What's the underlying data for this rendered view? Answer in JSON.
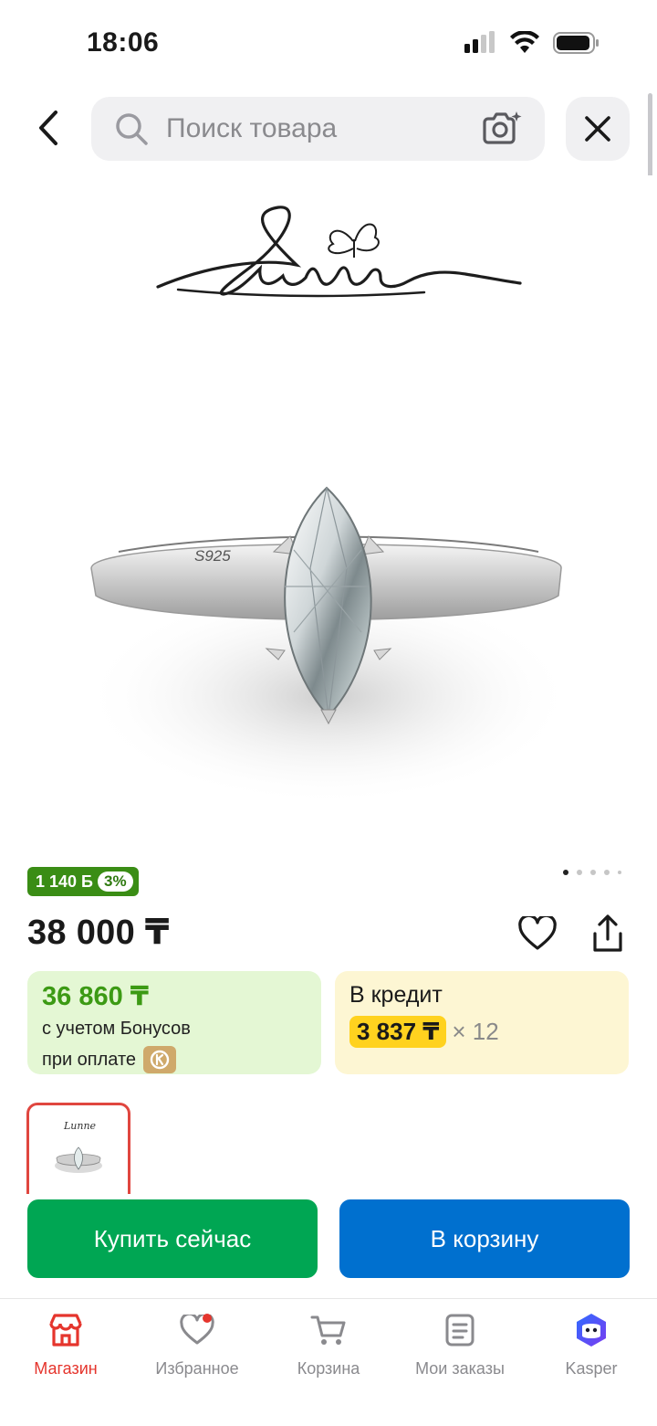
{
  "status_bar": {
    "time": "18:06",
    "icons": [
      "signal-icon",
      "wifi-icon",
      "battery-icon"
    ]
  },
  "header": {
    "search_placeholder": "Поиск товара",
    "icons": [
      "back-arrow-icon",
      "search-icon",
      "camera-search-icon",
      "close-icon"
    ]
  },
  "product": {
    "brand_logo_text": "Lunne",
    "ring_engraving": "S925",
    "image_count": 5,
    "active_image_index": 0,
    "bonus_amount": "1 140 Б",
    "bonus_percent": "3%",
    "price": "38 000 ₸",
    "bonus_price": "36 860 ₸",
    "bonus_line1": "с учетом Бонусов",
    "bonus_line2": "при оплате",
    "credit_title": "В кредит",
    "credit_amount": "3 837 ₸",
    "credit_term": "× 12",
    "thumbnail_logo_text": "Lunne"
  },
  "actions": {
    "buy_now": "Купить сейчас",
    "add_to_cart": "В корзину"
  },
  "bottom_nav": {
    "items": [
      {
        "label": "Магазин",
        "icon": "shop-icon",
        "active": true
      },
      {
        "label": "Избранное",
        "icon": "heart-icon",
        "active": false
      },
      {
        "label": "Корзина",
        "icon": "cart-icon",
        "active": false
      },
      {
        "label": "Мои заказы",
        "icon": "orders-icon",
        "active": false
      },
      {
        "label": "Kasper",
        "icon": "kasper-assistant-icon",
        "active": false
      }
    ]
  },
  "colors": {
    "buy_button": "#00a653",
    "cart_button": "#0070cf",
    "bonus_badge": "#3a8d15",
    "nav_active": "#e5352d",
    "credit_highlight": "#ffd21f"
  }
}
